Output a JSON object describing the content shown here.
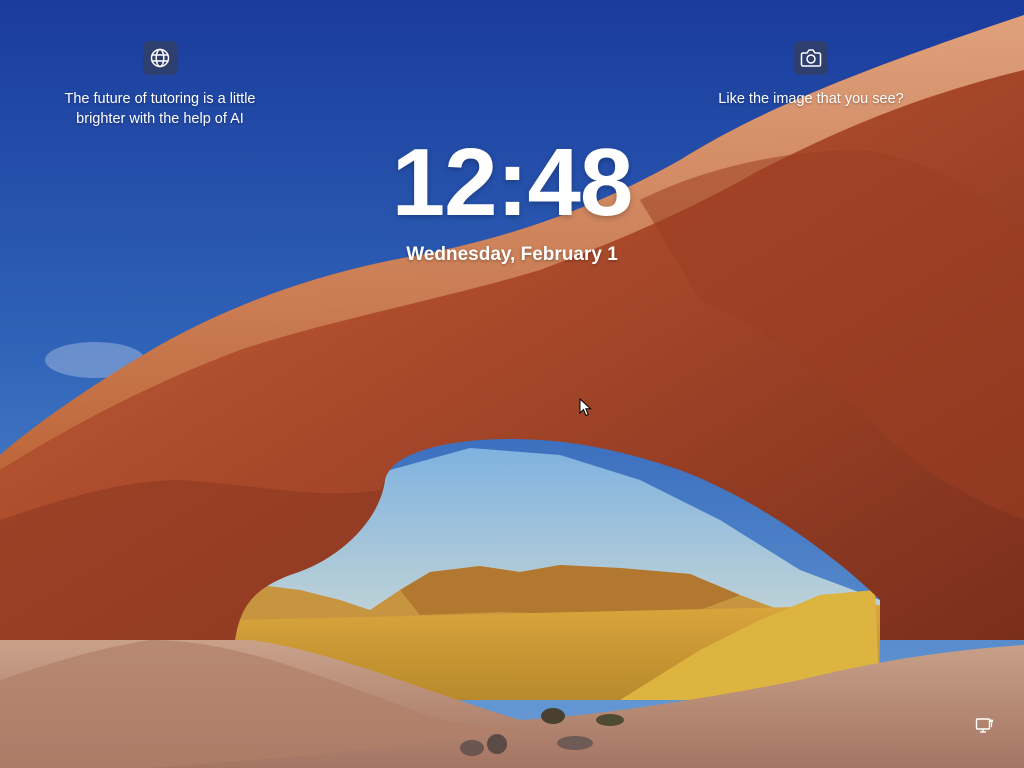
{
  "lockscreen": {
    "left_widget": {
      "icon": "globe-icon",
      "text": "The future of tutoring is a little brighter with the help of AI"
    },
    "right_widget": {
      "icon": "camera-icon",
      "text": "Like the image that you see?"
    },
    "time": "12:48",
    "date": "Wednesday, February 1"
  },
  "status": {
    "icon": "network-icon"
  },
  "colors": {
    "sky_top": "#1a3b9c",
    "sky_bottom": "#5a8fd0",
    "rock": "#b8572a",
    "sand": "#e0b045"
  }
}
